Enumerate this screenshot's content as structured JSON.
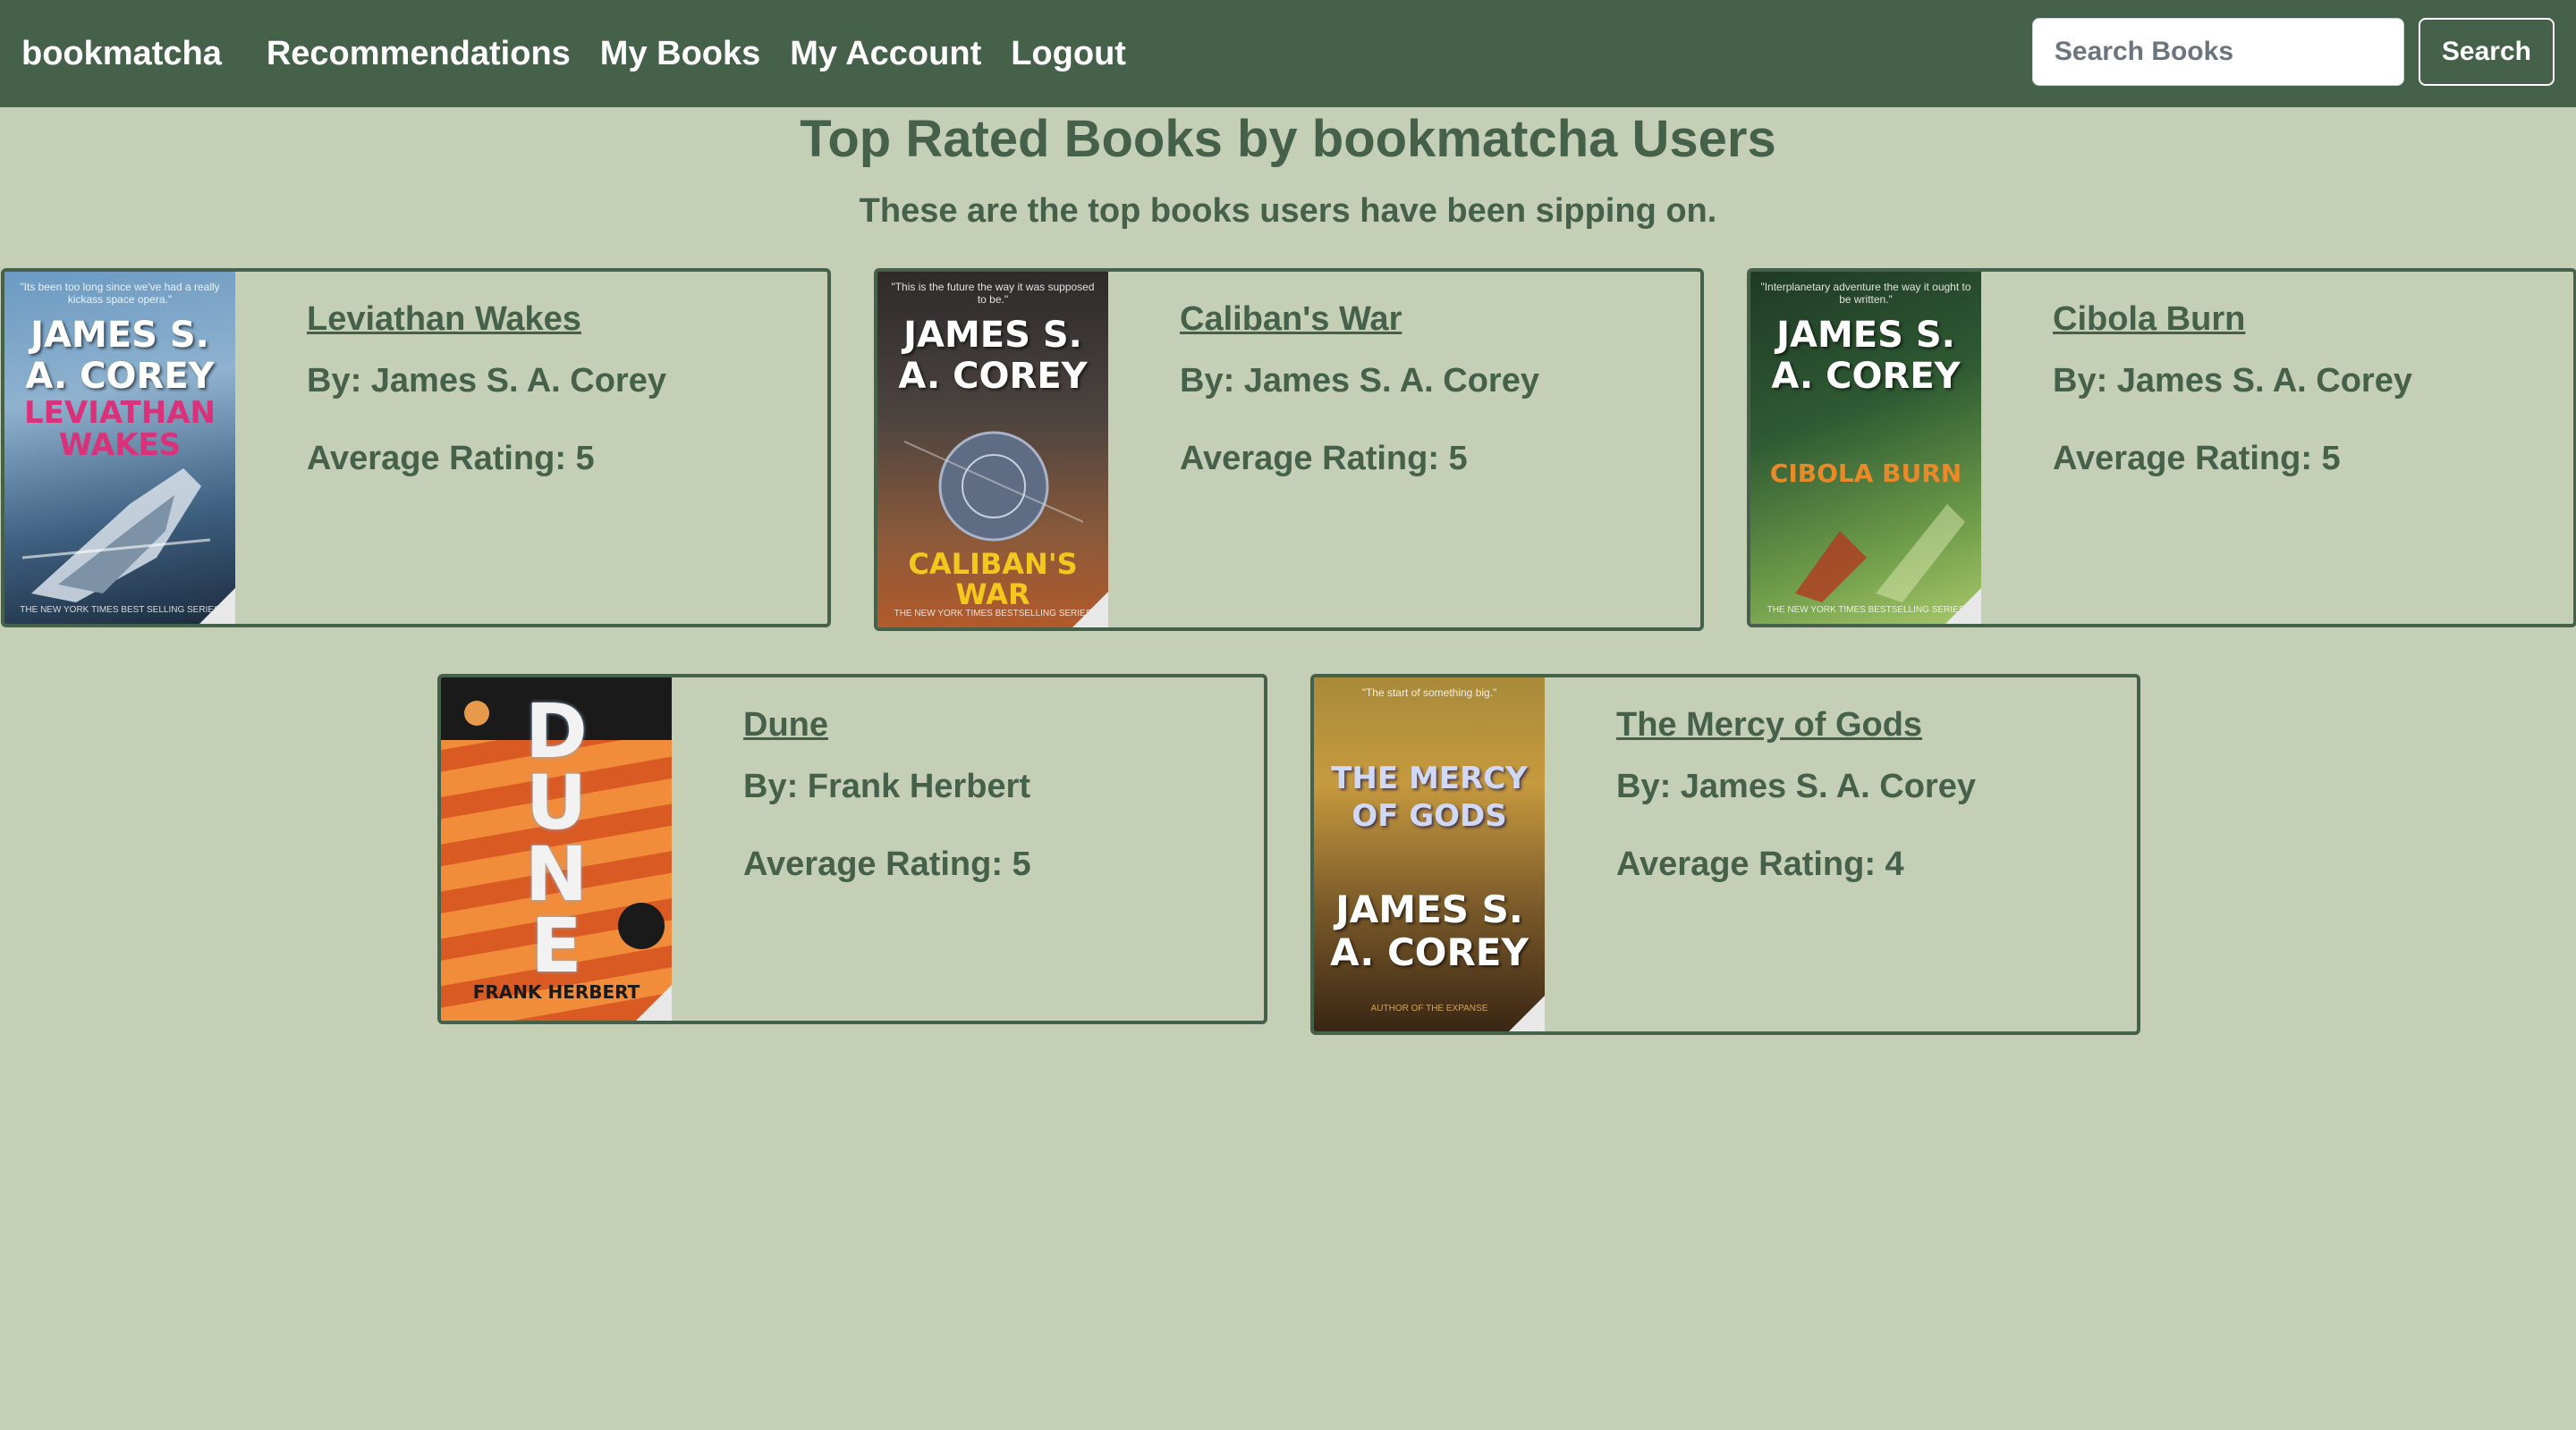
{
  "navbar": {
    "brand": "bookmatcha",
    "links": [
      {
        "label": "Recommendations"
      },
      {
        "label": "My Books"
      },
      {
        "label": "My Account"
      },
      {
        "label": "Logout"
      }
    ],
    "search": {
      "placeholder": "Search Books",
      "value": "",
      "button_label": "Search"
    }
  },
  "page": {
    "title": "Top Rated Books by bookmatcha Users",
    "subtitle": "These are the top books users have been sipping on."
  },
  "books": [
    {
      "title": "Leviathan Wakes",
      "author_line": "By: James S. A. Corey",
      "rating_line": "Average Rating: 5",
      "cover": {
        "author_text": "JAMES S. A. COREY",
        "title_text": "LEVIATHAN WAKES",
        "top_blurb": "\"Its been too long since we've had a really kickass space opera.\"",
        "bottom_blurb": "THE NEW YORK TIMES BEST SELLING SERIES",
        "title_color": "#d9317a",
        "bg_top": "#5d8fb8",
        "bg_bottom": "#1c2c3f"
      }
    },
    {
      "title": "Caliban's War",
      "author_line": "By: James S. A. Corey",
      "rating_line": "Average Rating: 5",
      "cover": {
        "author_text": "JAMES S. A. COREY",
        "title_text": "CALIBAN'S WAR",
        "top_blurb": "\"This is the future the way it was supposed to be.\"",
        "bottom_blurb": "THE NEW YORK TIMES BESTSELLING SERIES",
        "title_color": "#f2c81f",
        "bg_top": "#3b2d2a",
        "bg_bottom": "#b25a2b"
      }
    },
    {
      "title": "Cibola Burn",
      "author_line": "By: James S. A. Corey",
      "rating_line": "Average Rating: 5",
      "cover": {
        "author_text": "JAMES S. A. COREY",
        "title_text": "CIBOLA BURN",
        "top_blurb": "\"Interplanetary adventure the way it ought to be written.\"",
        "bottom_blurb": "THE NEW YORK TIMES BESTSELLING SERIES",
        "title_color": "#e8892a",
        "bg_top": "#24402a",
        "bg_bottom": "#7fae52"
      }
    },
    {
      "title": "Dune",
      "author_line": "By: Frank Herbert",
      "rating_line": "Average Rating: 5",
      "cover": {
        "author_text": "FRANK HERBERT",
        "title_text": "DUNE",
        "top_blurb": "",
        "bottom_blurb": "",
        "title_color": "#f2f2f2",
        "bg_top": "#e8752f",
        "bg_bottom": "#c8401c"
      }
    },
    {
      "title": "The Mercy of Gods",
      "author_line": "By: James S. A. Corey",
      "rating_line": "Average Rating: 4",
      "cover": {
        "author_text": "JAMES S. A. COREY",
        "title_text": "THE MERCY OF GODS",
        "top_blurb": "\"The start of something big.\"",
        "bottom_blurb": "AUTHOR OF THE EXPANSE",
        "title_color": "#cfd8f5",
        "bg_top": "#c79a3e",
        "bg_bottom": "#5a3b1e"
      }
    }
  ]
}
